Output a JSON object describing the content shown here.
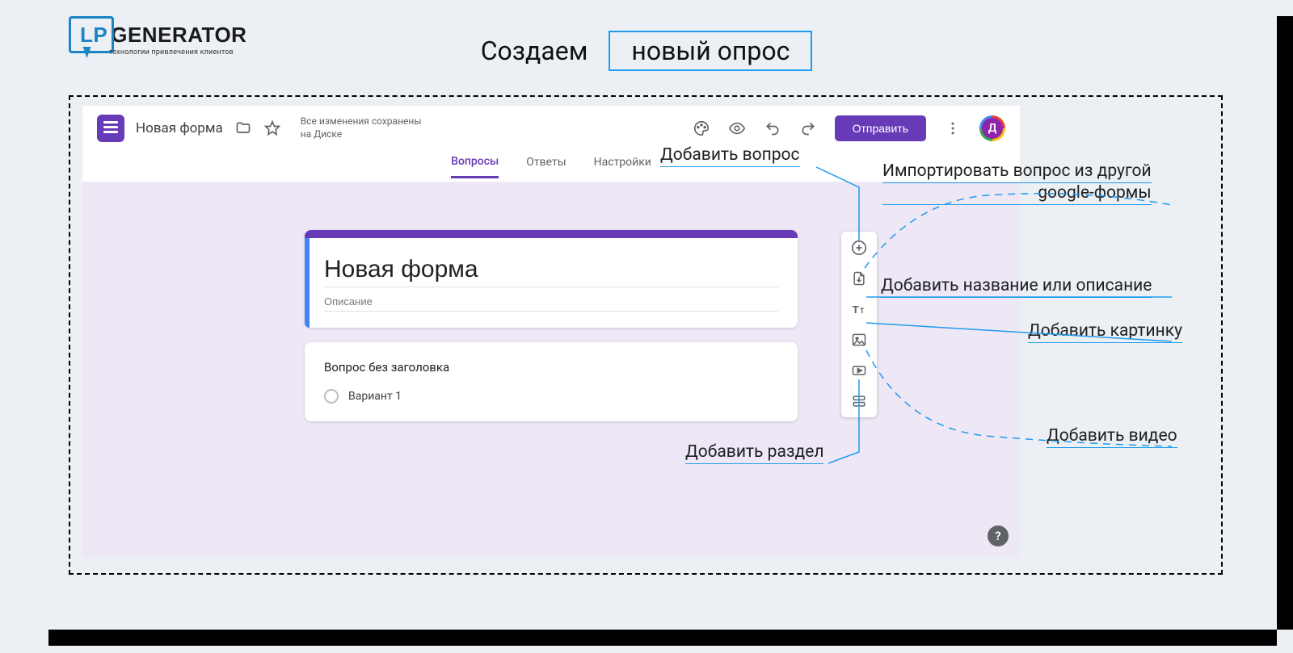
{
  "branding": {
    "logo_lp": "LP",
    "logo_gen": "GENERATOR",
    "logo_tagline": "технологии привлечения клиентов"
  },
  "heading": {
    "prefix": "Создаем",
    "highlight": "новый опрос"
  },
  "google_forms": {
    "doc_title": "Новая форма",
    "saved_line1": "Все изменения сохранены",
    "saved_line2": "на Диске",
    "tabs": {
      "questions": "Вопросы",
      "answers": "Ответы",
      "settings": "Настройки"
    },
    "send_button": "Отправить",
    "avatar_letter": "Д",
    "form_title": "Новая форма",
    "form_description_placeholder": "Описание",
    "question_title": "Вопрос без заголовка",
    "option1": "Вариант 1",
    "help_symbol": "?"
  },
  "annotations": {
    "add_question": "Добавить вопрос",
    "import_question_l1": "Импортировать вопрос из другой",
    "import_question_l2": "google-формы",
    "add_title_desc": "Добавить название или описание",
    "add_image": "Добавить картинку",
    "add_video": "Добавить видео",
    "add_section": "Добавить раздел"
  }
}
